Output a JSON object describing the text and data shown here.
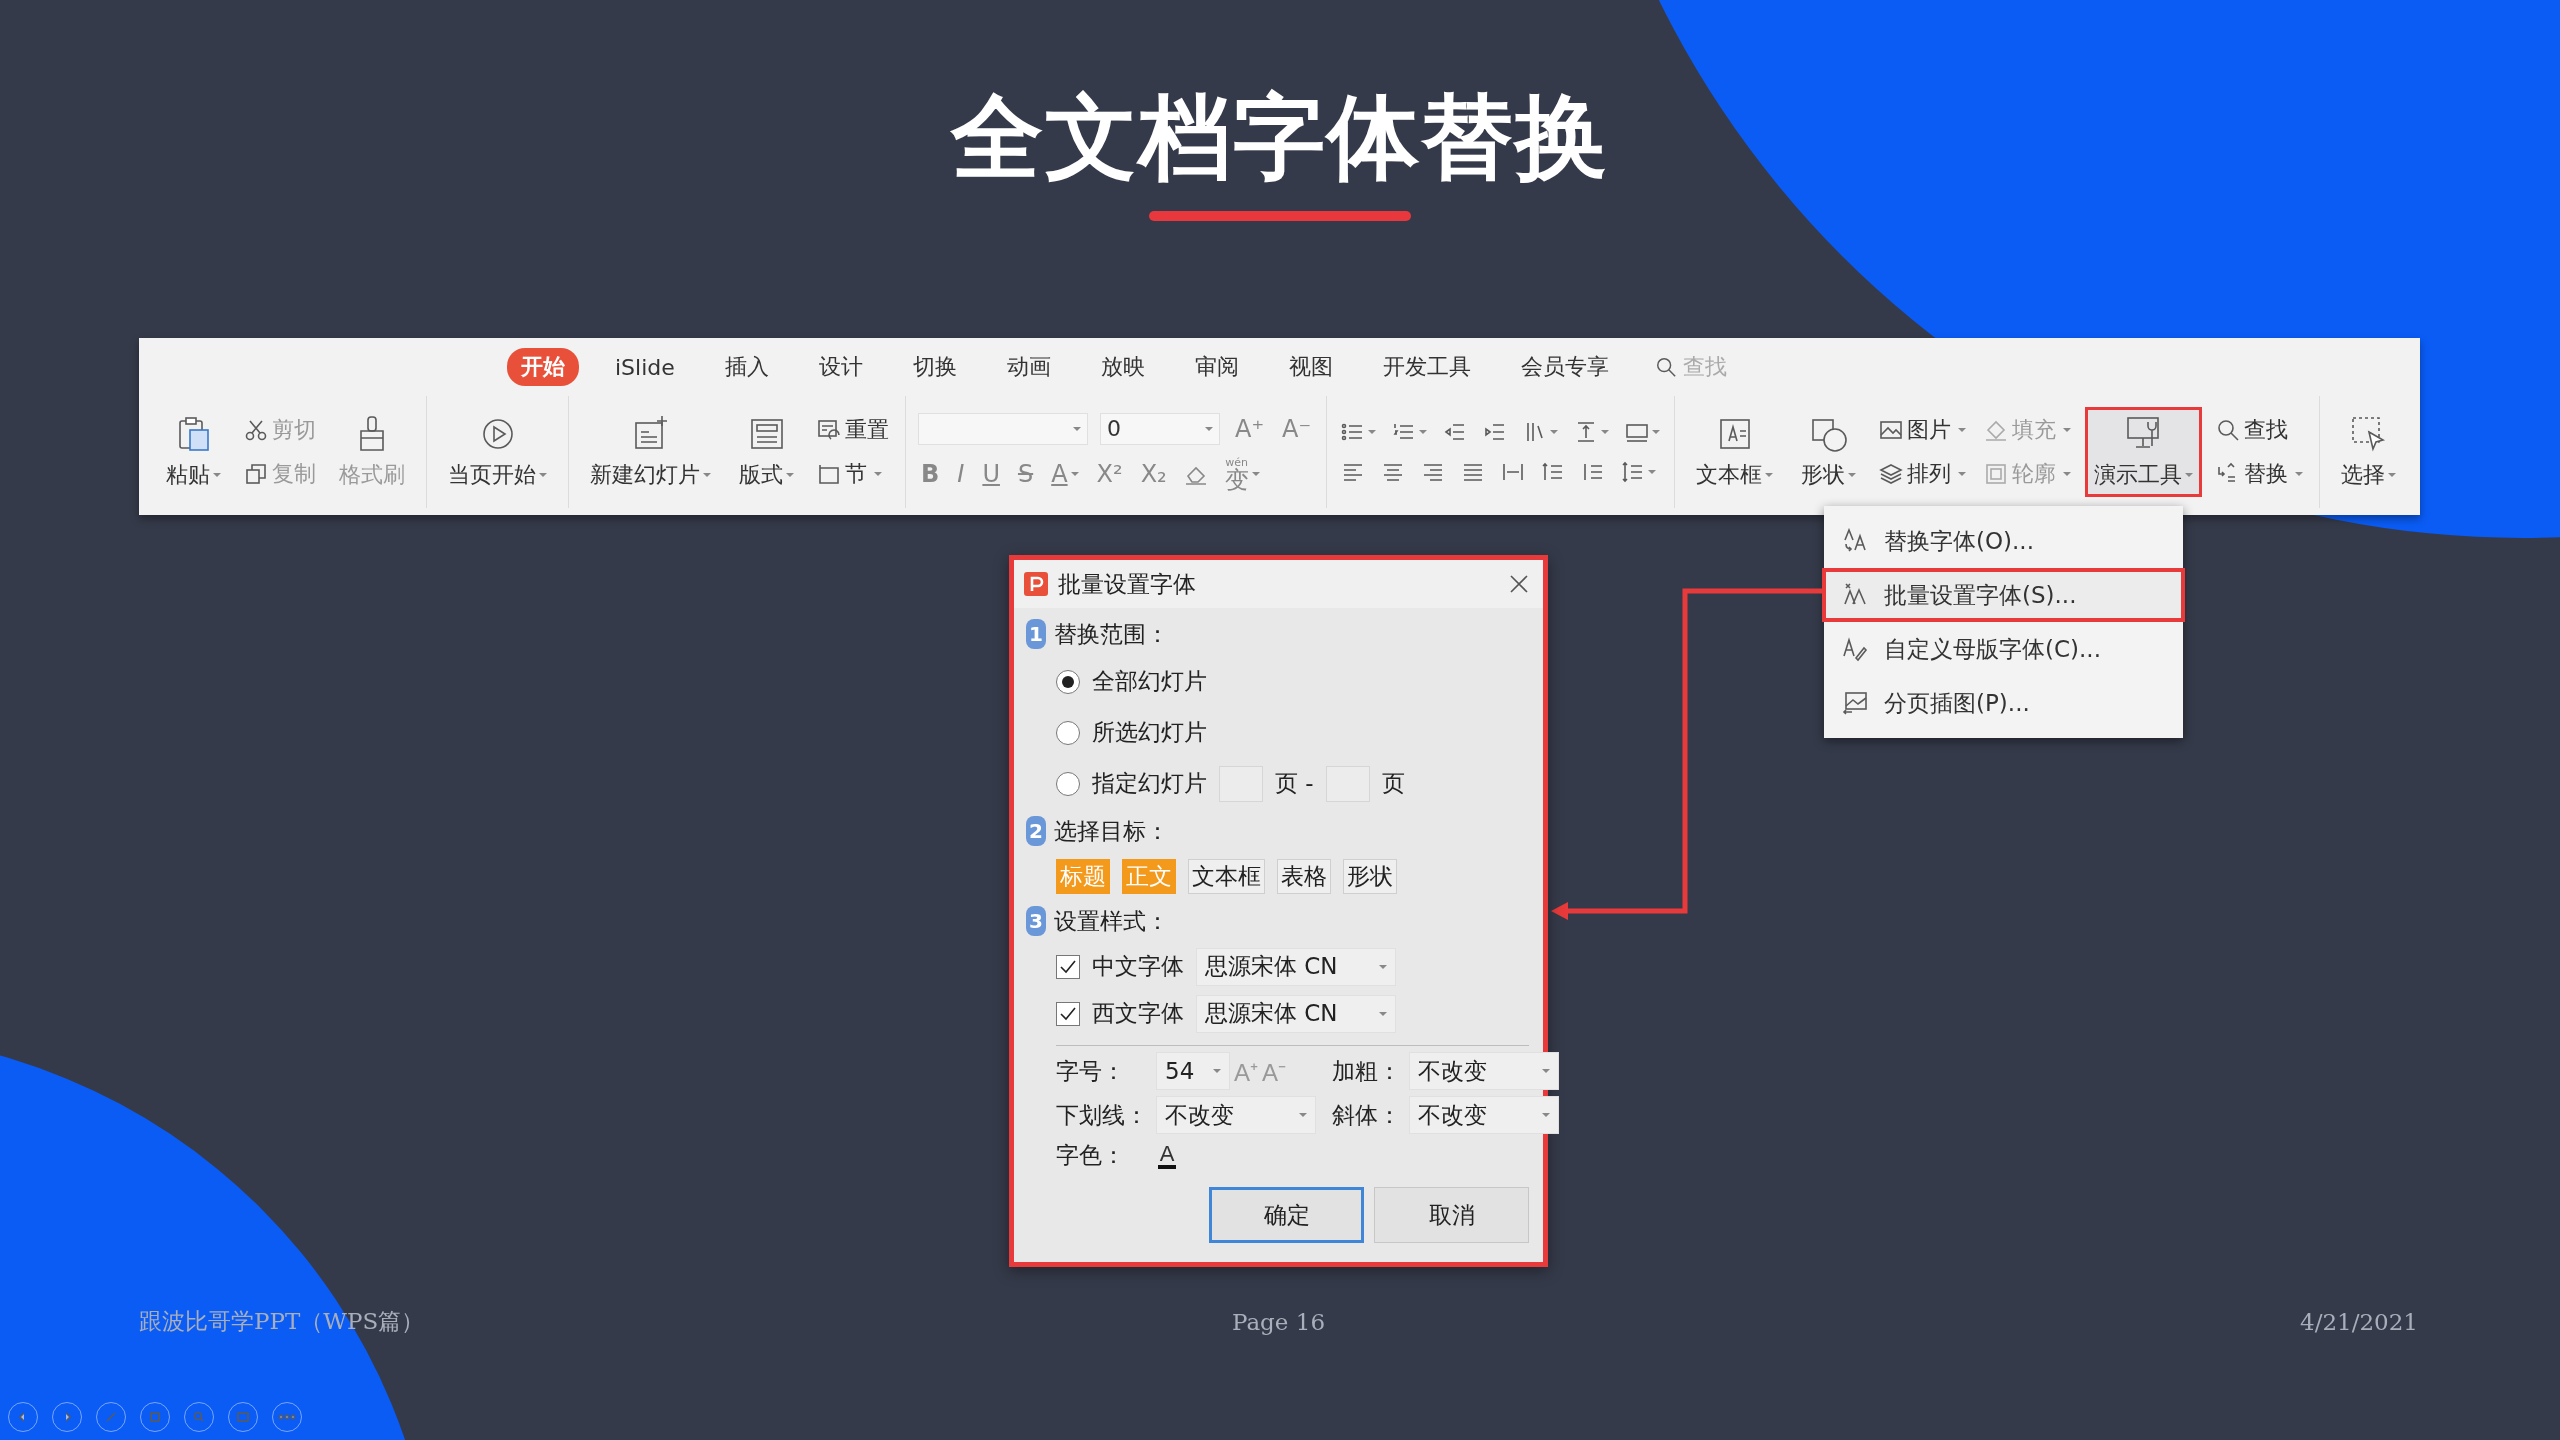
{
  "slide": {
    "title": "全文档字体替换",
    "footer_left": "跟波比哥学PPT（WPS篇）",
    "page": "Page 16",
    "date": "4/21/2021"
  },
  "ribbon": {
    "tabs": [
      {
        "label": "开始",
        "selected": true
      },
      {
        "label": "iSlide",
        "selected": false
      },
      {
        "label": "插入",
        "selected": false
      },
      {
        "label": "设计",
        "selected": false
      },
      {
        "label": "切换",
        "selected": false
      },
      {
        "label": "动画",
        "selected": false
      },
      {
        "label": "放映",
        "selected": false
      },
      {
        "label": "审阅",
        "selected": false
      },
      {
        "label": "视图",
        "selected": false
      },
      {
        "label": "开发工具",
        "selected": false
      },
      {
        "label": "会员专享",
        "selected": false
      }
    ],
    "search_placeholder": "查找",
    "groups": [
      [
        {
          "kind": "large",
          "label": "粘贴",
          "caret": true,
          "disabled": false,
          "highlighted": false
        },
        {
          "kind": "stack",
          "items": [
            {
              "label": "剪切",
              "caret": false,
              "disabled": true
            },
            {
              "label": "复制",
              "caret": false,
              "disabled": true
            }
          ]
        },
        {
          "kind": "large",
          "label": "格式刷",
          "caret": false,
          "disabled": true,
          "highlighted": false
        }
      ],
      [
        {
          "kind": "large",
          "label": "当页开始",
          "caret": true,
          "disabled": false,
          "highlighted": false
        }
      ],
      [
        {
          "kind": "large",
          "label": "新建幻灯片",
          "caret": true,
          "disabled": false,
          "highlighted": false
        },
        {
          "kind": "large",
          "label": "版式",
          "caret": true,
          "disabled": false,
          "highlighted": false
        },
        {
          "kind": "stack",
          "items": [
            {
              "label": "重置",
              "caret": false,
              "disabled": false
            },
            {
              "label": "节",
              "caret": true,
              "disabled": false
            }
          ]
        }
      ],
      [
        {
          "kind": "font",
          "font_size": "0",
          "size_buttons": [
            "A⁺",
            "A⁻"
          ],
          "format_buttons": [
            {
              "kind": "glyph",
              "glyph": "B",
              "caret": false
            },
            {
              "kind": "glyph",
              "glyph": "I",
              "caret": false
            },
            {
              "kind": "glyph",
              "glyph": "U",
              "caret": false
            },
            {
              "kind": "glyph",
              "glyph": "S",
              "caret": false
            },
            {
              "kind": "glyph",
              "glyph": "A",
              "caret": true
            },
            {
              "kind": "glyph",
              "glyph": "X²",
              "caret": false
            },
            {
              "kind": "glyph",
              "glyph": "X₂",
              "caret": false
            },
            {
              "kind": "eraser",
              "caret": false
            },
            {
              "kind": "glyph",
              "glyph": "变",
              "ruby": "wén",
              "caret": true
            }
          ]
        }
      ],
      [
        {
          "kind": "paragraph",
          "rows": [
            [
              {
                "caret": true
              },
              {
                "caret": true
              },
              {
                "caret": false
              },
              {
                "caret": false
              },
              {
                "caret": true
              },
              {
                "caret": true
              },
              {
                "caret": true
              }
            ],
            [
              {
                "caret": false
              },
              {
                "caret": false
              },
              {
                "caret": false
              },
              {
                "caret": false
              },
              {
                "caret": false
              },
              {
                "caret": false
              },
              {
                "caret": false
              },
              {
                "caret": true
              }
            ]
          ]
        }
      ],
      [
        {
          "kind": "large",
          "label": "文本框",
          "caret": true,
          "disabled": false,
          "highlighted": false
        },
        {
          "kind": "large",
          "label": "形状",
          "caret": true,
          "disabled": false,
          "highlighted": false
        },
        {
          "kind": "stack",
          "items": [
            {
              "label": "图片",
              "caret": true,
              "disabled": false
            },
            {
              "label": "排列",
              "caret": true,
              "disabled": false
            }
          ]
        },
        {
          "kind": "stack",
          "items": [
            {
              "label": "填充",
              "caret": true,
              "disabled": true
            },
            {
              "label": "轮廓",
              "caret": true,
              "disabled": true
            }
          ]
        },
        {
          "kind": "large",
          "label": "演示工具",
          "caret": true,
          "disabled": false,
          "highlighted": true
        },
        {
          "kind": "stack",
          "items": [
            {
              "label": "查找",
              "caret": false,
              "disabled": false
            },
            {
              "label": "替换",
              "caret": true,
              "disabled": false
            }
          ]
        }
      ],
      [
        {
          "kind": "large",
          "label": "选择",
          "caret": true,
          "disabled": false,
          "highlighted": false
        }
      ]
    ]
  },
  "menu": {
    "items": [
      {
        "label": "替换字体(O)...",
        "selected": false
      },
      {
        "label": "批量设置字体(S)...",
        "selected": true
      },
      {
        "label": "自定义母版字体(C)...",
        "selected": false
      },
      {
        "label": "分页插图(P)...",
        "selected": false
      }
    ]
  },
  "dialog": {
    "title": "批量设置字体",
    "range": {
      "number": "1",
      "label": "替换范围：",
      "options": [
        {
          "label": "全部幻灯片",
          "selected": true
        },
        {
          "label": "所选幻灯片",
          "selected": false
        },
        {
          "label": "指定幻灯片",
          "selected": false
        }
      ],
      "page_from_unit": "页 -",
      "page_to_unit": "页"
    },
    "target": {
      "number": "2",
      "label": "选择目标：",
      "options": [
        {
          "label": "标题",
          "selected": true
        },
        {
          "label": "正文",
          "selected": true
        },
        {
          "label": "文本框",
          "selected": false
        },
        {
          "label": "表格",
          "selected": false
        },
        {
          "label": "形状",
          "selected": false
        }
      ]
    },
    "style": {
      "number": "3",
      "label": "设置样式：",
      "fonts": [
        {
          "label": "中文字体",
          "checked": true,
          "value": "思源宋体 CN"
        },
        {
          "label": "西文字体",
          "checked": true,
          "value": "思源宋体 CN"
        }
      ],
      "size_label": "字号：",
      "size": "54",
      "size_buttons": [
        "A⁺",
        "A⁻"
      ],
      "bold_label": "加粗：",
      "bold": "不改变",
      "underline_label": "下划线：",
      "underline": "不改变",
      "italic_label": "斜体：",
      "italic": "不改变",
      "color_label": "字色：",
      "color_glyph": "A"
    },
    "buttons": [
      {
        "label": "确定",
        "kind": "primary"
      },
      {
        "label": "取消",
        "kind": "secondary"
      }
    ]
  }
}
